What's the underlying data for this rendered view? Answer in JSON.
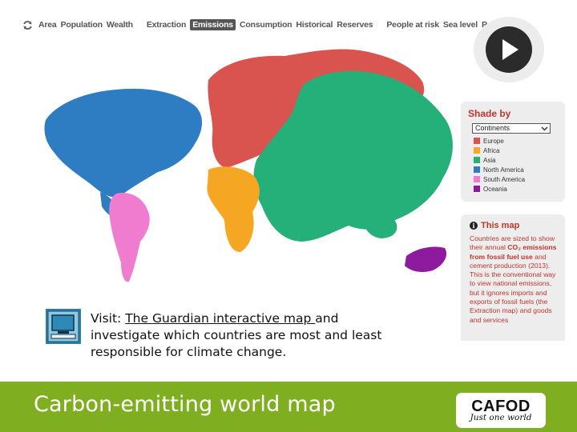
{
  "nav": {
    "items": [
      "Area",
      "Population",
      "Wealth",
      "Extraction",
      "Emissions",
      "Consumption",
      "Historical",
      "Reserves",
      "People at risk",
      "Sea level",
      "Poverty"
    ],
    "active": "Emissions"
  },
  "shade_panel": {
    "title": "Shade by",
    "selected": "Continents",
    "legend": [
      {
        "label": "Europe",
        "color": "#d9534f"
      },
      {
        "label": "Africa",
        "color": "#f5a623"
      },
      {
        "label": "Asia",
        "color": "#25b07a"
      },
      {
        "label": "North America",
        "color": "#2e7dc2"
      },
      {
        "label": "South America",
        "color": "#f07ccf"
      },
      {
        "label": "Oceania",
        "color": "#8e1a9e"
      }
    ]
  },
  "this_map": {
    "title": "This map",
    "text_1": "Countries are sized to show their annual ",
    "text_bold": "CO₂ emissions from fossil fuel use",
    "text_2": " and cement production (2013). This is the conventional way to view national emissions, but it ignores imports and exports of fossil fuels (the Extraction map) and goods and services"
  },
  "visit": {
    "prefix": "Visit: ",
    "link": "The Guardian interactive map ",
    "suffix": "and investigate which countries are most and least responsible for climate change."
  },
  "footer": {
    "title": "Carbon-emitting world map",
    "logo_brand": "CAFOD",
    "logo_tagline": "Just one world"
  }
}
